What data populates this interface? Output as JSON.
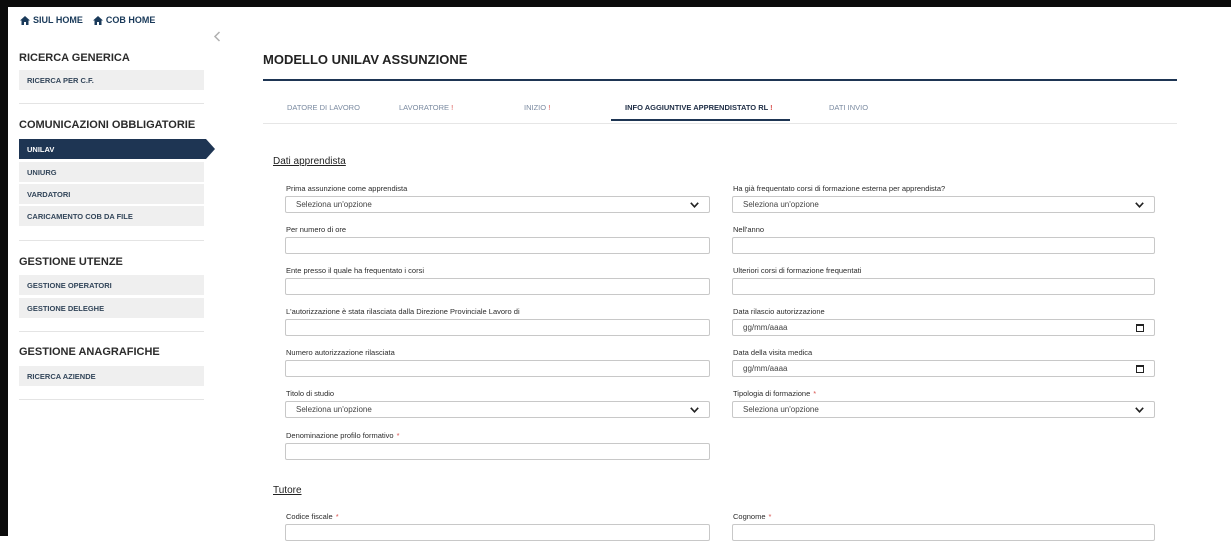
{
  "header": {
    "links": [
      {
        "label": "SIUL HOME",
        "icon": "home-icon"
      },
      {
        "label": "COB HOME",
        "icon": "home-icon"
      }
    ]
  },
  "sidebar": {
    "sections": [
      {
        "title": "RICERCA GENERICA",
        "items": [
          "RICERCA PER C.F."
        ]
      },
      {
        "title": "COMUNICAZIONI OBBLIGATORIE",
        "items": [
          "UNILAV",
          "UNIURG",
          "VARDATORI",
          "CARICAMENTO COB DA FILE"
        ],
        "active": "UNILAV"
      },
      {
        "title": "GESTIONE UTENZE",
        "items": [
          "GESTIONE OPERATORI",
          "GESTIONE DELEGHE"
        ]
      },
      {
        "title": "GESTIONE ANAGRAFICHE",
        "items": [
          "RICERCA AZIENDE"
        ]
      }
    ],
    "collapse_icon": "chevron-left-icon"
  },
  "main": {
    "title": "MODELLO UNILAV ASSUNZIONE",
    "tabs": [
      {
        "label": "DATORE DI LAVORO",
        "required": ""
      },
      {
        "label": "LAVORATORE",
        "required": "!"
      },
      {
        "label": "INIZIO",
        "required": "!"
      },
      {
        "label": "INFO AGGIUNTIVE APPRENDISTATO RL",
        "required": "!",
        "active": true
      },
      {
        "label": "DATI INVIO",
        "required": ""
      }
    ],
    "sections": {
      "apprendista": "Dati apprendista",
      "tutore": "Tutore"
    },
    "fields": {
      "prima_assunzione": {
        "label": "Prima assunzione come apprendista",
        "value": "Seleziona un'opzione"
      },
      "corsi_esterni": {
        "label": "Ha già frequentato corsi di formazione esterna per apprendista?",
        "value": "Seleziona un'opzione"
      },
      "numero_ore": {
        "label": "Per numero di ore",
        "value": ""
      },
      "anno": {
        "label": "Nell'anno",
        "value": ""
      },
      "ente": {
        "label": "Ente presso il quale ha frequentato i corsi",
        "value": ""
      },
      "ulteriori_corsi": {
        "label": "Ulteriori corsi di formazione frequentati",
        "value": ""
      },
      "autorizzazione": {
        "label": "L'autorizzazione è stata rilasciata dalla Direzione Provinciale Lavoro di",
        "value": ""
      },
      "data_rilascio": {
        "label": "Data rilascio autorizzazione",
        "value": "gg/mm/aaaa"
      },
      "numero_autorizzazione": {
        "label": "Numero autorizzazione rilasciata",
        "value": ""
      },
      "data_visita": {
        "label": "Data della visita medica",
        "value": "gg/mm/aaaa"
      },
      "titolo_studio": {
        "label": "Titolo di studio",
        "value": "Seleziona un'opzione"
      },
      "tipologia_formazione": {
        "label": "Tipologia di formazione",
        "required": "*",
        "value": "Seleziona un'opzione"
      },
      "profilo_formativo": {
        "label": "Denominazione profilo formativo",
        "required": "*",
        "value": ""
      },
      "codice_fiscale": {
        "label": "Codice fiscale",
        "required": "*",
        "value": ""
      },
      "cognome": {
        "label": "Cognome",
        "required": "*",
        "value": ""
      }
    }
  },
  "colors": {
    "accent": "#1e3553",
    "required": "#d9534f",
    "sidebar_item_bg": "#efefef"
  }
}
